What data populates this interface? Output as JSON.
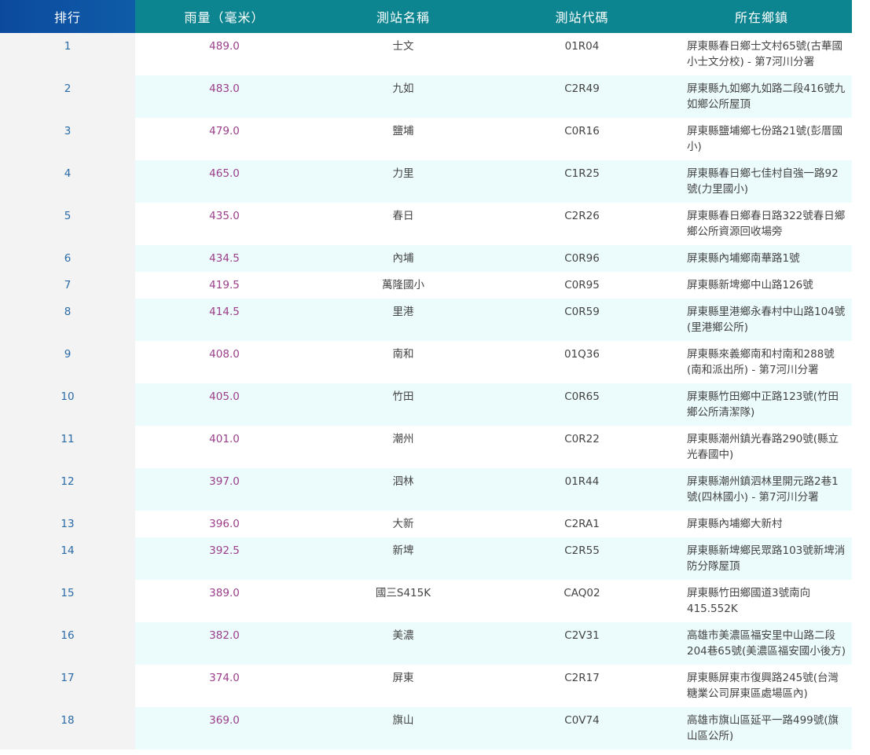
{
  "header": {
    "rank": "排行",
    "rainfall": "雨量（毫米）",
    "station_name": "測站名稱",
    "station_code": "測站代碼",
    "location": "所在鄉鎮"
  },
  "rows": [
    {
      "rank": "1",
      "rainfall": "489.0",
      "name": "士文",
      "code": "01R04",
      "address": "屏東縣春日鄉士文村65號(古華國小士文分校) - 第7河川分署",
      "lines": 2
    },
    {
      "rank": "2",
      "rainfall": "483.0",
      "name": "九如",
      "code": "C2R49",
      "address": "屏東縣九如鄉九如路二段416號九如鄉公所屋頂",
      "lines": 2
    },
    {
      "rank": "3",
      "rainfall": "479.0",
      "name": "鹽埔",
      "code": "C0R16",
      "address": "屏東縣鹽埔鄉七份路21號(彭厝國小)",
      "lines": 2
    },
    {
      "rank": "4",
      "rainfall": "465.0",
      "name": "力里",
      "code": "C1R25",
      "address": "屏東縣春日鄉七佳村自強一路92號(力里國小)",
      "lines": 2
    },
    {
      "rank": "5",
      "rainfall": "435.0",
      "name": "春日",
      "code": "C2R26",
      "address": "屏東縣春日鄉春日路322號春日鄉鄉公所資源回收場旁",
      "lines": 2
    },
    {
      "rank": "6",
      "rainfall": "434.5",
      "name": "內埔",
      "code": "C0R96",
      "address": "屏東縣內埔鄉南華路1號",
      "lines": 1
    },
    {
      "rank": "7",
      "rainfall": "419.5",
      "name": "萬隆國小",
      "code": "C0R95",
      "address": "屏東縣新埤鄉中山路126號",
      "lines": 1
    },
    {
      "rank": "8",
      "rainfall": "414.5",
      "name": "里港",
      "code": "C0R59",
      "address": "屏東縣里港鄉永春村中山路104號(里港鄉公所)",
      "lines": 2
    },
    {
      "rank": "9",
      "rainfall": "408.0",
      "name": "南和",
      "code": "01Q36",
      "address": "屏東縣來義鄉南和村南和288號(南和派出所) - 第7河川分署",
      "lines": 2
    },
    {
      "rank": "10",
      "rainfall": "405.0",
      "name": "竹田",
      "code": "C0R65",
      "address": "屏東縣竹田鄉中正路123號(竹田鄉公所清潔隊)",
      "lines": 2
    },
    {
      "rank": "11",
      "rainfall": "401.0",
      "name": "潮州",
      "code": "C0R22",
      "address": "屏東縣潮州鎮光春路290號(縣立光春國中)",
      "lines": 2
    },
    {
      "rank": "12",
      "rainfall": "397.0",
      "name": "泗林",
      "code": "01R44",
      "address": "屏東縣潮州鎮泗林里開元路2巷1號(四林國小) - 第7河川分署",
      "lines": 2
    },
    {
      "rank": "13",
      "rainfall": "396.0",
      "name": "大新",
      "code": "C2RA1",
      "address": "屏東縣內埔鄉大新村",
      "lines": 1
    },
    {
      "rank": "14",
      "rainfall": "392.5",
      "name": "新埤",
      "code": "C2R55",
      "address": "屏東縣新埤鄉民眾路103號新埤消防分隊屋頂",
      "lines": 2
    },
    {
      "rank": "15",
      "rainfall": "389.0",
      "name": "國三S415K",
      "code": "CAQ02",
      "address": "屏東縣竹田鄉國道3號南向415.552K",
      "lines": 2
    },
    {
      "rank": "16",
      "rainfall": "382.0",
      "name": "美濃",
      "code": "C2V31",
      "address": "高雄市美濃區福安里中山路二段204巷65號(美濃區福安國小後方)",
      "lines": 2
    },
    {
      "rank": "17",
      "rainfall": "374.0",
      "name": "屏東",
      "code": "C2R17",
      "address": "屏東縣屏東市復興路245號(台灣糖業公司屏東區處場區內)",
      "lines": 2
    },
    {
      "rank": "18",
      "rainfall": "369.0",
      "name": "旗山",
      "code": "C0V74",
      "address": "高雄市旗山區延平一路499號(旗山區公所)",
      "lines": 2
    }
  ]
}
